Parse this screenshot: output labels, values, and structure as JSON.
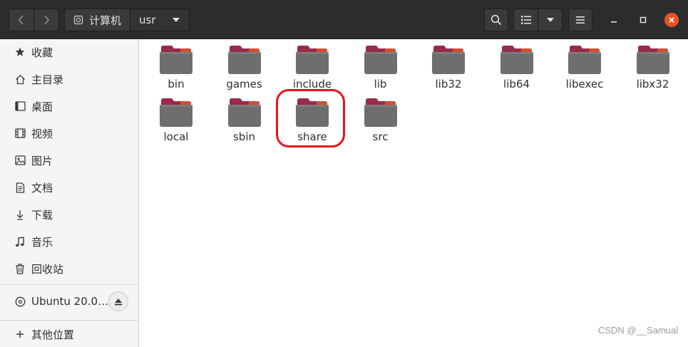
{
  "header": {
    "path": [
      "计算机",
      "usr"
    ],
    "icons": {
      "back": "chevron-left-icon",
      "forward": "chevron-right-icon",
      "drive": "drive-icon",
      "dropdown": "triangle-down-icon",
      "search": "search-icon",
      "list_view": "list-view-icon",
      "view_options": "triangle-down-icon",
      "menu": "hamburger-icon",
      "minimize": "minimize-icon",
      "maximize": "maximize-icon",
      "close": "close-icon"
    }
  },
  "sidebar": {
    "items": [
      {
        "label": "收藏",
        "icon": "star-icon"
      },
      {
        "label": "主目录",
        "icon": "home-icon"
      },
      {
        "label": "桌面",
        "icon": "desktop-icon"
      },
      {
        "label": "视频",
        "icon": "video-icon"
      },
      {
        "label": "图片",
        "icon": "picture-icon"
      },
      {
        "label": "文档",
        "icon": "document-icon"
      },
      {
        "label": "下载",
        "icon": "download-icon"
      },
      {
        "label": "音乐",
        "icon": "music-icon"
      },
      {
        "label": "回收站",
        "icon": "trash-icon"
      }
    ],
    "device": {
      "label": "Ubuntu 20.0…",
      "icon": "disc-icon",
      "eject_icon": "eject-icon"
    },
    "other": {
      "label": "其他位置",
      "icon": "plus-icon"
    }
  },
  "main": {
    "folders": [
      {
        "name": "bin"
      },
      {
        "name": "games"
      },
      {
        "name": "include"
      },
      {
        "name": "lib"
      },
      {
        "name": "lib32"
      },
      {
        "name": "lib64"
      },
      {
        "name": "libexec"
      },
      {
        "name": "libx32"
      },
      {
        "name": "local"
      },
      {
        "name": "sbin"
      },
      {
        "name": "share"
      },
      {
        "name": "src"
      }
    ],
    "highlighted": "share"
  },
  "colors": {
    "folder_tab": "#9a2a4a",
    "folder_tab_edge": "#e0552a",
    "folder_body": "#6e6e6e",
    "highlight": "#e8141c",
    "close_button": "#e95420"
  },
  "watermark": "CSDN @__Samual"
}
